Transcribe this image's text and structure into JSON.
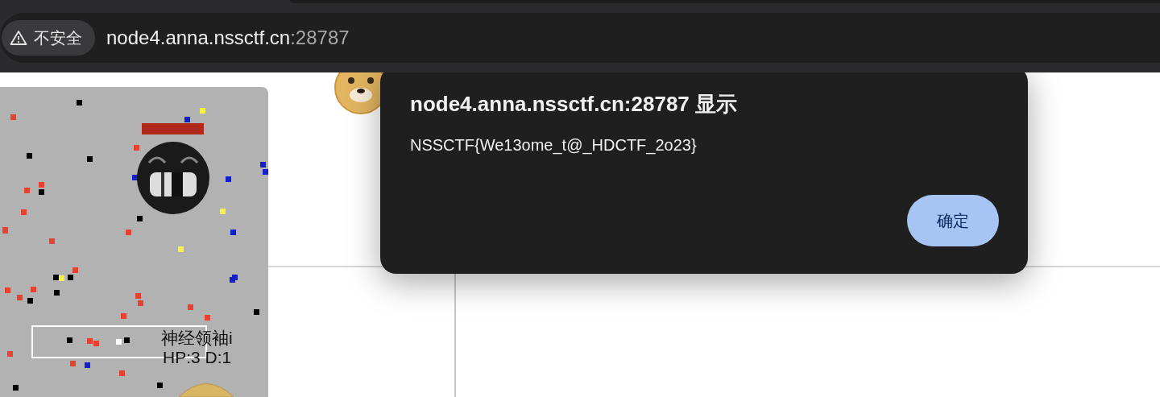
{
  "browser": {
    "security_label": "不安全",
    "url_host": "node4.anna.nssctf.cn",
    "url_port": ":28787"
  },
  "game": {
    "player_name": "神经领袖i",
    "player_stats": "HP:3 D:1"
  },
  "dialog": {
    "title": "node4.anna.nssctf.cn:28787 显示",
    "message": "NSSCTF{We13ome_t@_HDCTF_2o23}",
    "buttons": [
      "确定"
    ]
  }
}
